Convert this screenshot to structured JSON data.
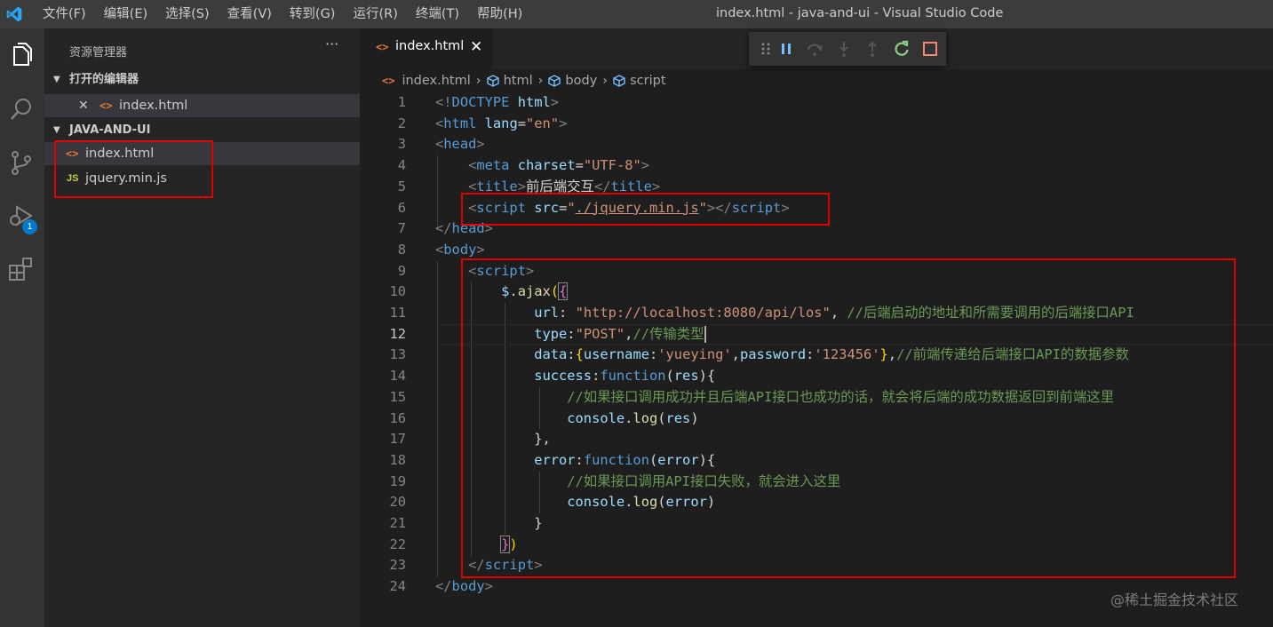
{
  "titlebar": {
    "menu": [
      "文件(F)",
      "编辑(E)",
      "选择(S)",
      "查看(V)",
      "转到(G)",
      "运行(R)",
      "终端(T)",
      "帮助(H)"
    ],
    "window_title": "index.html - java-and-ui - Visual Studio Code"
  },
  "activitybar": {
    "icons": [
      "explorer-icon",
      "search-icon",
      "source-control-icon",
      "run-debug-icon",
      "extensions-icon"
    ],
    "debug_badge": "1"
  },
  "sidebar": {
    "title": "资源管理器",
    "more": "···",
    "open_editors_label": "打开的编辑器",
    "open_editors": [
      {
        "name": "index.html",
        "close": "✕"
      }
    ],
    "project_label": "JAVA-AND-UI",
    "files": [
      {
        "name": "index.html",
        "icon": "<>",
        "type": "html"
      },
      {
        "name": "jquery.min.js",
        "icon": "JS",
        "type": "js"
      }
    ]
  },
  "tabs": [
    {
      "label": "index.html",
      "close": "✕"
    }
  ],
  "breadcrumb": [
    "index.html",
    "html",
    "body",
    "script"
  ],
  "editor": {
    "current_line": 12,
    "line_numbers": [
      "1",
      "2",
      "3",
      "4",
      "5",
      "6",
      "7",
      "8",
      "9",
      "10",
      "11",
      "12",
      "13",
      "14",
      "15",
      "16",
      "17",
      "18",
      "19",
      "20",
      "21",
      "22",
      "23",
      "24"
    ]
  },
  "watermark": "@稀土掘金技术社区",
  "colors": {
    "highlight_box": "#e00000",
    "accent": "#007acc"
  }
}
